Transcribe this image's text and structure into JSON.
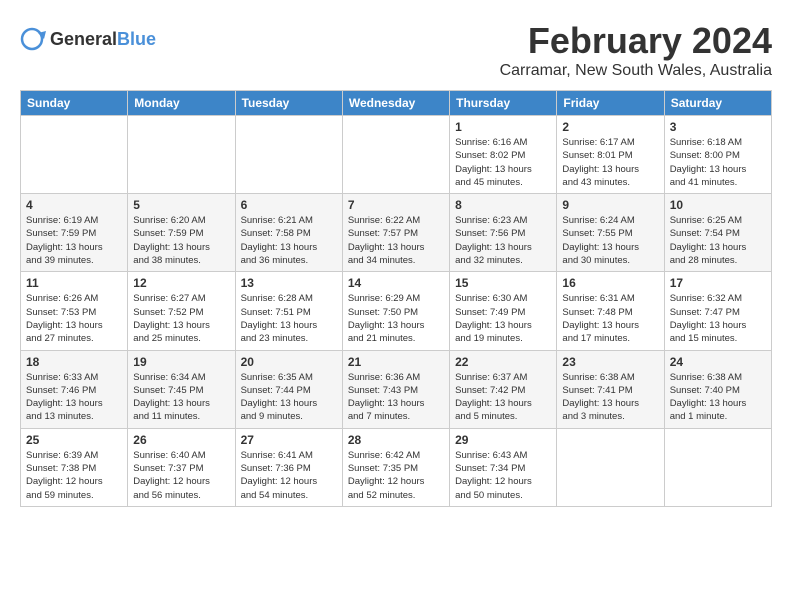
{
  "header": {
    "logo_general": "General",
    "logo_blue": "Blue",
    "month_title": "February 2024",
    "location": "Carramar, New South Wales, Australia"
  },
  "weekdays": [
    "Sunday",
    "Monday",
    "Tuesday",
    "Wednesday",
    "Thursday",
    "Friday",
    "Saturday"
  ],
  "weeks": [
    [
      {
        "day": "",
        "info": ""
      },
      {
        "day": "",
        "info": ""
      },
      {
        "day": "",
        "info": ""
      },
      {
        "day": "",
        "info": ""
      },
      {
        "day": "1",
        "info": "Sunrise: 6:16 AM\nSunset: 8:02 PM\nDaylight: 13 hours\nand 45 minutes."
      },
      {
        "day": "2",
        "info": "Sunrise: 6:17 AM\nSunset: 8:01 PM\nDaylight: 13 hours\nand 43 minutes."
      },
      {
        "day": "3",
        "info": "Sunrise: 6:18 AM\nSunset: 8:00 PM\nDaylight: 13 hours\nand 41 minutes."
      }
    ],
    [
      {
        "day": "4",
        "info": "Sunrise: 6:19 AM\nSunset: 7:59 PM\nDaylight: 13 hours\nand 39 minutes."
      },
      {
        "day": "5",
        "info": "Sunrise: 6:20 AM\nSunset: 7:59 PM\nDaylight: 13 hours\nand 38 minutes."
      },
      {
        "day": "6",
        "info": "Sunrise: 6:21 AM\nSunset: 7:58 PM\nDaylight: 13 hours\nand 36 minutes."
      },
      {
        "day": "7",
        "info": "Sunrise: 6:22 AM\nSunset: 7:57 PM\nDaylight: 13 hours\nand 34 minutes."
      },
      {
        "day": "8",
        "info": "Sunrise: 6:23 AM\nSunset: 7:56 PM\nDaylight: 13 hours\nand 32 minutes."
      },
      {
        "day": "9",
        "info": "Sunrise: 6:24 AM\nSunset: 7:55 PM\nDaylight: 13 hours\nand 30 minutes."
      },
      {
        "day": "10",
        "info": "Sunrise: 6:25 AM\nSunset: 7:54 PM\nDaylight: 13 hours\nand 28 minutes."
      }
    ],
    [
      {
        "day": "11",
        "info": "Sunrise: 6:26 AM\nSunset: 7:53 PM\nDaylight: 13 hours\nand 27 minutes."
      },
      {
        "day": "12",
        "info": "Sunrise: 6:27 AM\nSunset: 7:52 PM\nDaylight: 13 hours\nand 25 minutes."
      },
      {
        "day": "13",
        "info": "Sunrise: 6:28 AM\nSunset: 7:51 PM\nDaylight: 13 hours\nand 23 minutes."
      },
      {
        "day": "14",
        "info": "Sunrise: 6:29 AM\nSunset: 7:50 PM\nDaylight: 13 hours\nand 21 minutes."
      },
      {
        "day": "15",
        "info": "Sunrise: 6:30 AM\nSunset: 7:49 PM\nDaylight: 13 hours\nand 19 minutes."
      },
      {
        "day": "16",
        "info": "Sunrise: 6:31 AM\nSunset: 7:48 PM\nDaylight: 13 hours\nand 17 minutes."
      },
      {
        "day": "17",
        "info": "Sunrise: 6:32 AM\nSunset: 7:47 PM\nDaylight: 13 hours\nand 15 minutes."
      }
    ],
    [
      {
        "day": "18",
        "info": "Sunrise: 6:33 AM\nSunset: 7:46 PM\nDaylight: 13 hours\nand 13 minutes."
      },
      {
        "day": "19",
        "info": "Sunrise: 6:34 AM\nSunset: 7:45 PM\nDaylight: 13 hours\nand 11 minutes."
      },
      {
        "day": "20",
        "info": "Sunrise: 6:35 AM\nSunset: 7:44 PM\nDaylight: 13 hours\nand 9 minutes."
      },
      {
        "day": "21",
        "info": "Sunrise: 6:36 AM\nSunset: 7:43 PM\nDaylight: 13 hours\nand 7 minutes."
      },
      {
        "day": "22",
        "info": "Sunrise: 6:37 AM\nSunset: 7:42 PM\nDaylight: 13 hours\nand 5 minutes."
      },
      {
        "day": "23",
        "info": "Sunrise: 6:38 AM\nSunset: 7:41 PM\nDaylight: 13 hours\nand 3 minutes."
      },
      {
        "day": "24",
        "info": "Sunrise: 6:38 AM\nSunset: 7:40 PM\nDaylight: 13 hours\nand 1 minute."
      }
    ],
    [
      {
        "day": "25",
        "info": "Sunrise: 6:39 AM\nSunset: 7:38 PM\nDaylight: 12 hours\nand 59 minutes."
      },
      {
        "day": "26",
        "info": "Sunrise: 6:40 AM\nSunset: 7:37 PM\nDaylight: 12 hours\nand 56 minutes."
      },
      {
        "day": "27",
        "info": "Sunrise: 6:41 AM\nSunset: 7:36 PM\nDaylight: 12 hours\nand 54 minutes."
      },
      {
        "day": "28",
        "info": "Sunrise: 6:42 AM\nSunset: 7:35 PM\nDaylight: 12 hours\nand 52 minutes."
      },
      {
        "day": "29",
        "info": "Sunrise: 6:43 AM\nSunset: 7:34 PM\nDaylight: 12 hours\nand 50 minutes."
      },
      {
        "day": "",
        "info": ""
      },
      {
        "day": "",
        "info": ""
      }
    ]
  ]
}
